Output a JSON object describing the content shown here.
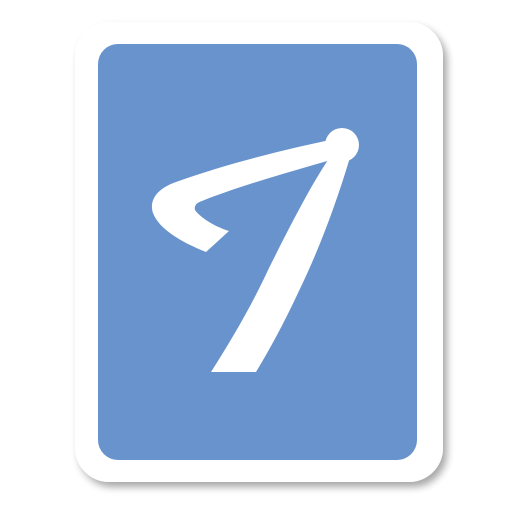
{
  "icon": {
    "name": "app-icon",
    "colors": {
      "tile": "#6893CD",
      "frame": "#FFFFFF",
      "glyph": "#FFFFFF",
      "shadow": "#000000"
    }
  }
}
